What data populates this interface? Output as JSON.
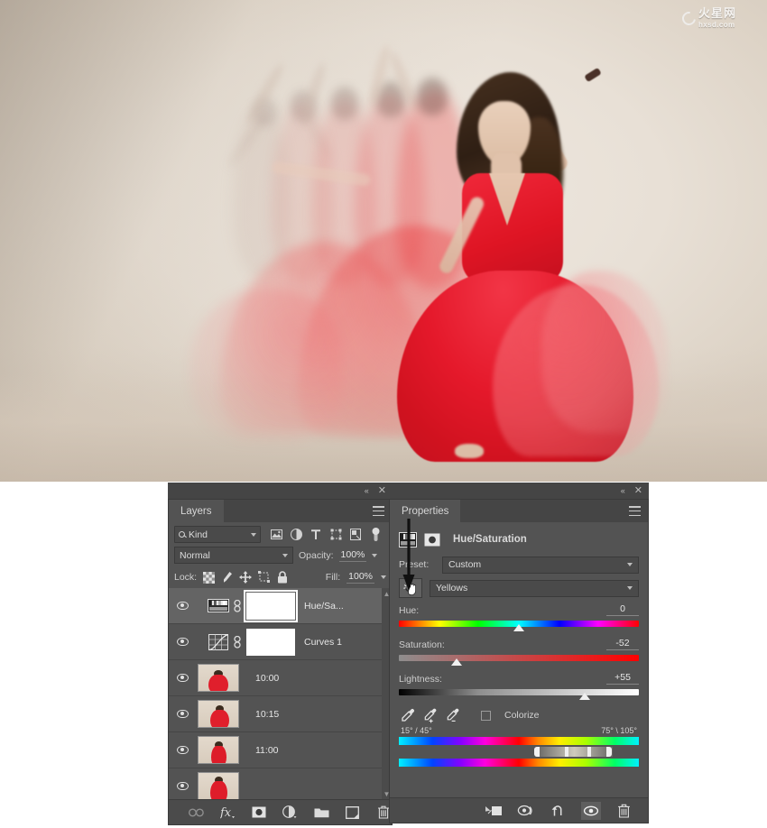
{
  "watermark": {
    "cn": "火星网",
    "domain": "hxsd.com"
  },
  "panel_bar": {
    "collapse": "«",
    "close": "✕"
  },
  "layers": {
    "tab_label": "Layers",
    "filter": {
      "kind_label": "Kind",
      "icons": [
        "pixel-filter-icon",
        "adjustment-filter-icon",
        "type-filter-icon",
        "shape-filter-icon",
        "smart-object-filter-icon",
        "filter-toggle-icon"
      ]
    },
    "blend_mode": "Normal",
    "opacity_label": "Opacity:",
    "opacity_value": "100%",
    "lock_label": "Lock:",
    "lock_icons": [
      "lock-transparency-icon",
      "lock-image-icon",
      "lock-position-icon",
      "lock-artboard-icon",
      "lock-all-icon"
    ],
    "fill_label": "Fill:",
    "fill_value": "100%",
    "rows": [
      {
        "name": "Hue/Sa...",
        "type": "adjustment",
        "kind": "hue-saturation",
        "visible": true,
        "selected": true,
        "linked": true,
        "mask_active": true
      },
      {
        "name": "Curves 1",
        "type": "adjustment",
        "kind": "curves",
        "visible": true,
        "selected": false,
        "linked": true,
        "mask_active": false
      },
      {
        "name": "10:00",
        "type": "image",
        "visible": true,
        "selected": false
      },
      {
        "name": "10:15",
        "type": "image",
        "visible": true,
        "selected": false
      },
      {
        "name": "11:00",
        "type": "image",
        "visible": true,
        "selected": false
      },
      {
        "name": "",
        "type": "image",
        "visible": true,
        "selected": false
      }
    ],
    "bottom_buttons": [
      "link-layers-icon",
      "layer-style-fx-icon",
      "add-layer-mask-icon",
      "new-adjustment-layer-icon",
      "new-group-icon",
      "new-layer-icon",
      "delete-layer-icon"
    ]
  },
  "properties": {
    "tab_label": "Properties",
    "adjustment_title": "Hue/Saturation",
    "preset_label": "Preset:",
    "preset_value": "Custom",
    "channel_value": "Yellows",
    "sliders": [
      {
        "label": "Hue:",
        "value": "0",
        "pos_pct": 50
      },
      {
        "label": "Saturation:",
        "value": "-52",
        "pos_pct": 24
      },
      {
        "label": "Lightness:",
        "value": "+55",
        "pos_pct": 77.5
      }
    ],
    "eyedroppers": [
      "eyedropper-icon",
      "eyedropper-add-icon",
      "eyedropper-subtract-icon"
    ],
    "colorize_label": "Colorize",
    "colorize_checked": false,
    "range_left": "15° / 45°",
    "range_right": "75° \\ 105°",
    "range_handles_pct": [
      58,
      70,
      79,
      87
    ],
    "bottom_buttons": [
      "clip-to-layer-icon",
      "view-previous-state-icon",
      "reset-icon",
      "toggle-visibility-icon",
      "delete-adjustment-icon"
    ],
    "visibility_on": true
  },
  "colors": {
    "panel_bg": "#535353",
    "panel_header": "#454545",
    "toolbar_bg": "#4b4b4b",
    "selected_row": "#646464",
    "text": "#dcdcdc",
    "dress_red": "#e8192c"
  }
}
